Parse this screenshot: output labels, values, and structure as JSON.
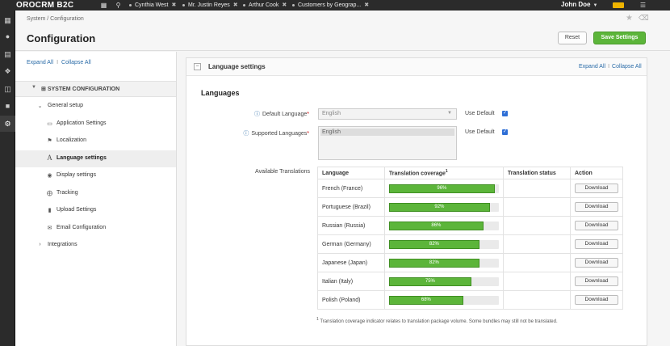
{
  "topbar": {
    "logo": "OROCRM B2C",
    "pins": [
      {
        "label": "Cynthia West"
      },
      {
        "label": "Mr. Justin Reyes"
      },
      {
        "label": "Arthur Cook"
      },
      {
        "label": "Customers by Geograp..."
      }
    ],
    "user": "John Doe",
    "icons": [
      "dashboard-icon",
      "search-icon",
      "bell-icon",
      "list-icon"
    ],
    "badge_color": "#f0b400"
  },
  "leftnav": {
    "items": [
      "dashboard-icon",
      "users-icon",
      "cart-icon",
      "puzzle-icon",
      "sitemap-icon",
      "folder-icon",
      "gear-icon"
    ],
    "active": "gear-icon"
  },
  "header": {
    "breadcrumb": "System / Configuration",
    "title": "Configuration",
    "reset_label": "Reset",
    "save_label": "Save Settings"
  },
  "tree": {
    "expand_all": "Expand All",
    "separator": "I",
    "collapse_all": "Collapse All",
    "root": "SYSTEM CONFIGURATION",
    "group": "General setup",
    "items": [
      {
        "label": "Application Settings",
        "icon": "monitor-icon"
      },
      {
        "label": "Localization",
        "icon": "flag-icon"
      },
      {
        "label": "Language settings",
        "icon": "font-icon"
      },
      {
        "label": "Display settings",
        "icon": "eye-icon"
      },
      {
        "label": "Tracking",
        "icon": "crosshair-icon"
      },
      {
        "label": "Upload Settings",
        "icon": "file-icon"
      },
      {
        "label": "Email Configuration",
        "icon": "envelope-icon"
      }
    ],
    "integrations": "Integrations"
  },
  "section": {
    "title": "Language settings",
    "expand_all": "Expand All",
    "separator": "I",
    "collapse_all": "Collapse All",
    "subheading": "Languages",
    "default_language_label": "Default Language",
    "default_language_value": "English",
    "supported_languages_label": "Supported Languages",
    "supported_languages_value": "English",
    "use_default_label": "Use Default",
    "available_translations_label": "Available Translations",
    "table": {
      "headers": [
        "Language",
        "Translation coverage",
        "Translation status",
        "Action"
      ],
      "coverage_sup": "1",
      "rows": [
        {
          "language": "French (France)",
          "coverage": 96,
          "coverage_label": "96%",
          "status": "",
          "action": "Download"
        },
        {
          "language": "Portuguese (Brazil)",
          "coverage": 92,
          "coverage_label": "92%",
          "status": "",
          "action": "Download"
        },
        {
          "language": "Russian (Russia)",
          "coverage": 86,
          "coverage_label": "86%",
          "status": "",
          "action": "Download"
        },
        {
          "language": "German (Germany)",
          "coverage": 82,
          "coverage_label": "82%",
          "status": "",
          "action": "Download"
        },
        {
          "language": "Japanese (Japan)",
          "coverage": 82,
          "coverage_label": "82%",
          "status": "",
          "action": "Download"
        },
        {
          "language": "Italian (Italy)",
          "coverage": 75,
          "coverage_label": "75%",
          "status": "",
          "action": "Download"
        },
        {
          "language": "Polish (Poland)",
          "coverage": 68,
          "coverage_label": "68%",
          "status": "",
          "action": "Download"
        }
      ]
    },
    "footnote_sup": "1",
    "footnote": "Translation coverage indicator relates to translation package volume. Some bundles may still not be translated."
  },
  "colors": {
    "accent": "#5cb53a",
    "link": "#2b6ca8",
    "topbar": "#2b2b2b"
  }
}
